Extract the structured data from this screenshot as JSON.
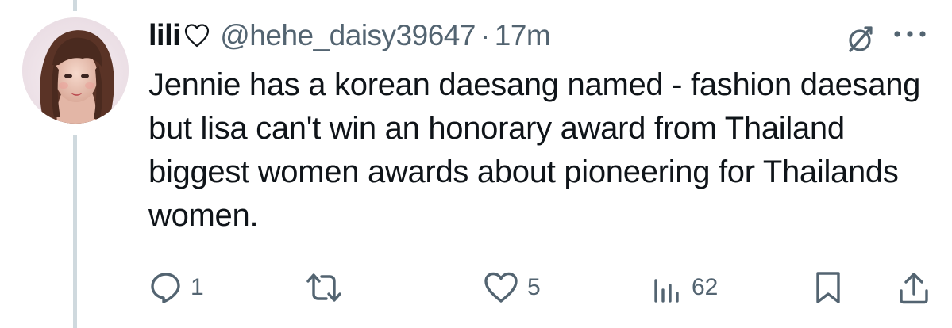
{
  "tweet": {
    "display_name": "lili",
    "name_suffix_icon": "heart-outline-icon",
    "handle": "@hehe_daisy39647",
    "separator": "·",
    "time": "17m",
    "text": "Jennie has a korean daesang named - fashion daesang but lisa can't win an honorary award from Thailand biggest women awards about pioneering for Thailands women."
  },
  "actions": {
    "reply": {
      "icon": "reply-icon",
      "count": "1"
    },
    "retweet": {
      "icon": "retweet-icon",
      "count": ""
    },
    "like": {
      "icon": "heart-icon",
      "count": "5"
    },
    "views": {
      "icon": "views-icon",
      "count": "62"
    },
    "bookmark": {
      "icon": "bookmark-icon"
    },
    "share": {
      "icon": "share-icon"
    }
  },
  "colors": {
    "text_primary": "#0f1419",
    "text_secondary": "#536471",
    "thread_line": "#cfd9de",
    "background": "#ffffff"
  }
}
